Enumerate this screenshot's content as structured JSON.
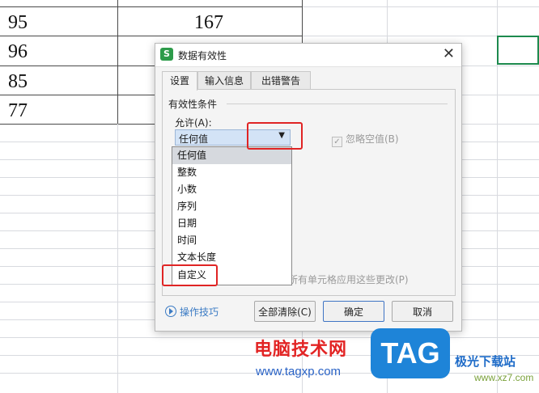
{
  "sheet": {
    "column_b_visible": "167",
    "column_a_values": [
      "95",
      "96",
      "85",
      "77"
    ]
  },
  "dialog": {
    "title": "数据有效性",
    "tabs": [
      "设置",
      "输入信息",
      "出错警告"
    ],
    "group_title": "有效性条件",
    "allow_label": "允许(A):",
    "allow_value": "任何值",
    "ignore_blank": "忽略空值(B)",
    "apply_all": "所有单元格应用这些更改(P)",
    "tips": "操作技巧",
    "buttons": {
      "clear_all": "全部清除(C)",
      "ok": "确定",
      "cancel": "取消"
    },
    "dropdown_options": [
      "任何值",
      "整数",
      "小数",
      "序列",
      "日期",
      "时间",
      "文本长度",
      "自定义"
    ],
    "dropdown_selected": "任何值"
  },
  "watermark": {
    "site_name": "电脑技术网",
    "site_url": "www.tagxp.com",
    "logo_text": "TAG",
    "partner": "极光下载站",
    "partner_url": "www.xz7.com"
  },
  "colors": {
    "highlight_red": "#e02424",
    "selected_cell_green": "#1d8a4e",
    "brand_blue": "#1e84d8"
  }
}
